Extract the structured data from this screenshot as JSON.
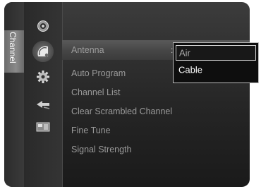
{
  "side_tab": {
    "label": "Channel"
  },
  "icons": [
    {
      "name": "picture-icon"
    },
    {
      "name": "channel-icon"
    },
    {
      "name": "setup-icon"
    },
    {
      "name": "input-icon"
    },
    {
      "name": "application-icon"
    }
  ],
  "menu": {
    "items": [
      {
        "label": "Antenna",
        "selected": true,
        "value_separator": ":"
      },
      {
        "label": "Auto Program"
      },
      {
        "label": "Channel List"
      },
      {
        "label": "Clear Scrambled Channel"
      },
      {
        "label": "Fine Tune"
      },
      {
        "label": "Signal Strength"
      }
    ]
  },
  "dropdown": {
    "options": [
      {
        "label": "Air",
        "highlighted": true
      },
      {
        "label": "Cable"
      }
    ]
  },
  "colors": {
    "panel": "#262626",
    "selected_row": "#4a4a4a",
    "text_dim": "#9a9a9a",
    "text_bright": "#ffffff",
    "dropdown_border": "#bdbdbd"
  }
}
